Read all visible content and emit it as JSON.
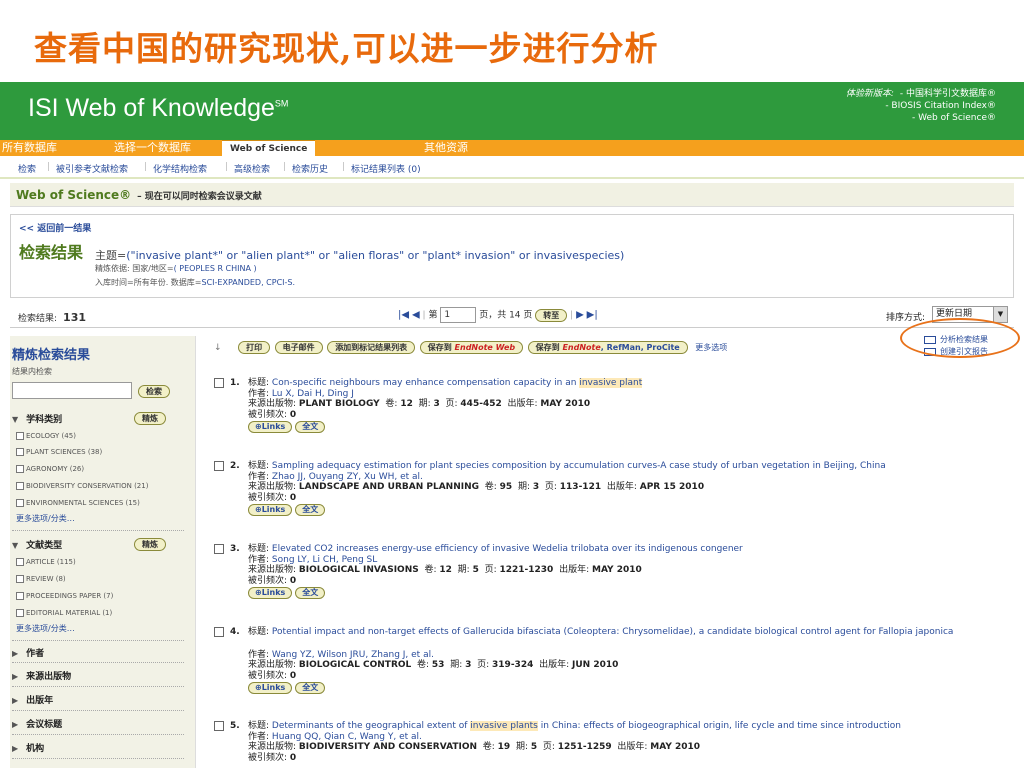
{
  "slide_title": "查看中国的研究现状,可以进一步进行分析",
  "header": {
    "logo": "ISI Web of Knowledge",
    "logo_mark": "SM",
    "db_label": "体验新版本:",
    "db_lines": [
      "- 中国科学引文数据库®",
      "- BIOSIS Citation Index®",
      "- Web of Science®"
    ]
  },
  "tabs": [
    "所有数据库",
    "选择一个数据库",
    "Web of Science",
    "其他资源"
  ],
  "subnav": [
    "检索",
    "被引参考文献检索",
    "化学结构检索",
    "高级检索",
    "检索历史",
    "标记结果列表 (0)"
  ],
  "wos": {
    "title": "Web of Science®",
    "subtitle": "– 现在可以同时检索会议录文献"
  },
  "query": {
    "back": "<< 返回前一结果",
    "results_title": "检索结果",
    "topic_label": "主题=",
    "topic_value": "(\"invasive plant*\" or \"alien plant*\" or \"alien floras\" or \"plant* invasion\" or invasivespecies)",
    "refine_label": "精炼依据: 国家/地区=",
    "refine_value": "( PEOPLES R CHINA )",
    "range_label": "入库时间=所有年份. 数据库=",
    "range_value": "SCI-EXPANDED, CPCI-S."
  },
  "pager": {
    "count_label": "检索结果:",
    "count": "131",
    "page_label": "第",
    "page_value": "1",
    "of_label": "页，共 14 页",
    "go": "转至",
    "sort_label": "排序方式:",
    "sort_value": "更新日期"
  },
  "sidebar": {
    "title": "精炼检索结果",
    "sub": "结果内检索",
    "search_btn": "检索",
    "refine_btn": "精炼",
    "more": "更多选项/分类…",
    "sec1": "学科类别",
    "sec1_items": [
      "ECOLOGY (45)",
      "PLANT SCIENCES (38)",
      "AGRONOMY (26)",
      "BIODIVERSITY CONSERVATION (21)",
      "ENVIRONMENTAL SCIENCES (15)"
    ],
    "sec2": "文献类型",
    "sec2_items": [
      "ARTICLE (115)",
      "REVIEW (8)",
      "PROCEEDINGS PAPER (7)",
      "EDITORIAL MATERIAL (1)"
    ],
    "collapsed": [
      "作者",
      "来源出版物",
      "出版年",
      "会议标题",
      "机构"
    ]
  },
  "toolbar": {
    "print": "打印",
    "email": "电子邮件",
    "add": "添加到标记结果列表",
    "save_to": "保存到",
    "endnote_web": "EndNote Web",
    "save_to2": "保存到",
    "endnote": "EndNote",
    "refman": ", RefMan, ProCite",
    "more": "更多选项"
  },
  "analysis": {
    "analyze": "分析检索结果",
    "citation": "创建引文报告"
  },
  "labels": {
    "title": "标题:",
    "author": "作者:",
    "source": "来源出版物:",
    "vol": "卷:",
    "issue": "期:",
    "page": "页:",
    "date": "出版年:",
    "cited": "被引频次:",
    "links": "Links",
    "fulltext": "全文"
  },
  "results": [
    {
      "n": "1.",
      "title_pre": "Con-specific neighbours may enhance compensation capacity in an ",
      "title_hl": "invasive plant",
      "title_post": "",
      "authors": "Lu X, Dai H, Ding J",
      "source": "PLANT BIOLOGY",
      "vol": "12",
      "issue": "3",
      "pages": "445-452",
      "date": "MAY 2010",
      "cited": "0"
    },
    {
      "n": "2.",
      "title_pre": "Sampling adequacy estimation for plant species composition by accumulation curves-A case study of urban vegetation in Beijing, China",
      "title_hl": "",
      "title_post": "",
      "authors": "Zhao JJ, Ouyang ZY, Xu WH, et al.",
      "source": "LANDSCAPE AND URBAN PLANNING",
      "vol": "95",
      "issue": "3",
      "pages": "113-121",
      "date": "APR 15 2010",
      "cited": "0"
    },
    {
      "n": "3.",
      "title_pre": "Elevated CO2 increases energy-use efficiency of invasive Wedelia trilobata over its indigenous congener",
      "title_hl": "",
      "title_post": "",
      "authors": "Song LY, Li CH, Peng SL",
      "source": "BIOLOGICAL INVASIONS",
      "vol": "12",
      "issue": "5",
      "pages": "1221-1230",
      "date": "MAY 2010",
      "cited": "0"
    },
    {
      "n": "4.",
      "title_pre": "Potential impact and non-target effects of Gallerucida bifasciata (Coleoptera: Chrysomelidae), a candidate biological control agent for Fallopia japonica",
      "title_hl": "",
      "title_post": "",
      "authors": "Wang YZ, Wilson JRU, Zhang J, et al.",
      "source": "BIOLOGICAL CONTROL",
      "vol": "53",
      "issue": "3",
      "pages": "319-324",
      "date": "JUN 2010",
      "cited": "0"
    },
    {
      "n": "5.",
      "title_pre": "Determinants of the geographical extent of ",
      "title_hl": "invasive plants",
      "title_post": " in China: effects of biogeographical origin, life cycle and time since introduction",
      "authors": "Huang QQ, Qian C, Wang Y, et al.",
      "source": "BIODIVERSITY AND CONSERVATION",
      "vol": "19",
      "issue": "5",
      "pages": "1251-1259",
      "date": "MAY 2010",
      "cited": "0"
    }
  ]
}
